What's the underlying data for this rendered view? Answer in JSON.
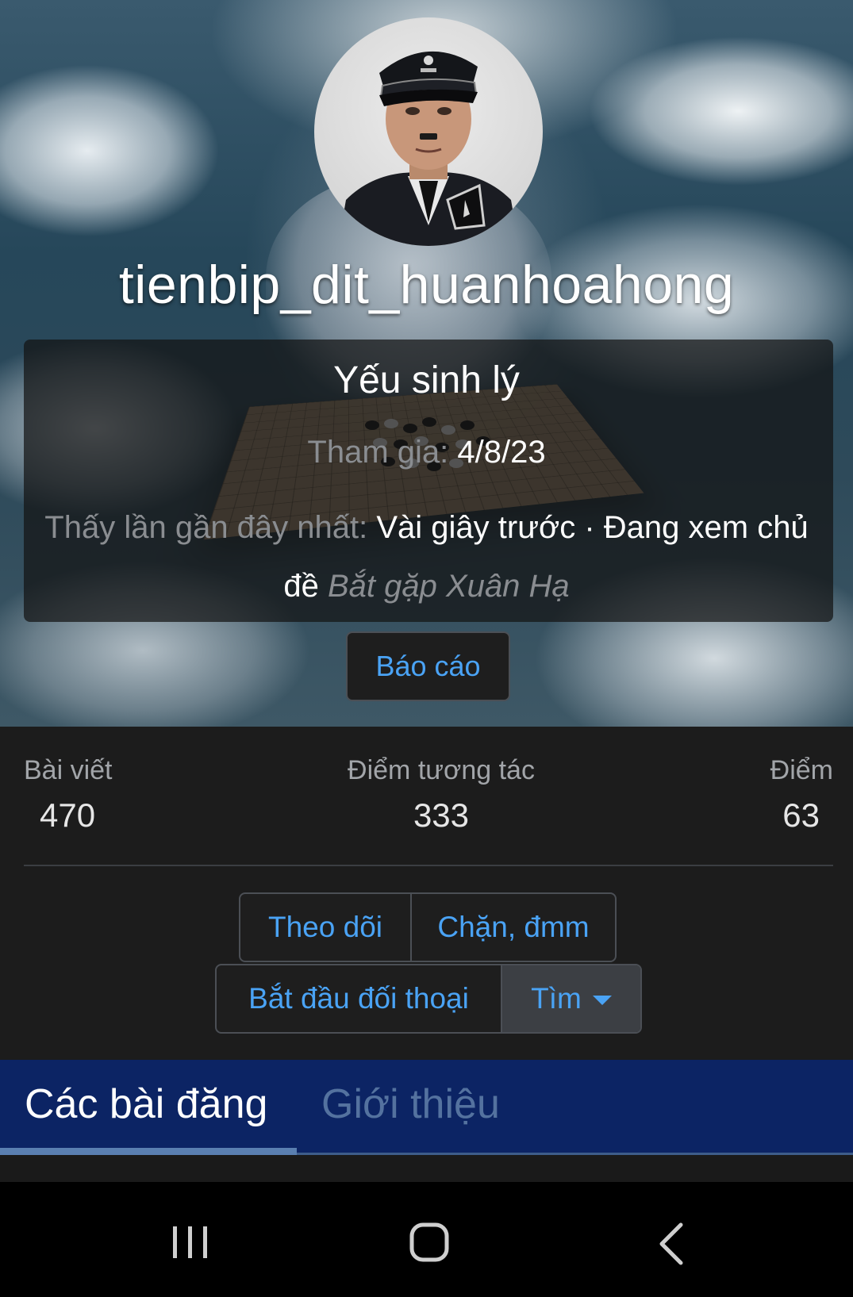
{
  "profile": {
    "username": "tienbip_dit_huanhoahong",
    "user_title": "Yếu sinh lý",
    "joined_label": "Tham gia:",
    "joined_value": "4/8/23",
    "last_seen_label": "Thấy lần gần đây nhất:",
    "last_seen_value": "Vài giây trước · Đang xem chủ đề",
    "last_seen_thread": "Bắt gặp Xuân Hạ",
    "report_label": "Báo cáo"
  },
  "stats": [
    {
      "label": "Bài viết",
      "value": "470"
    },
    {
      "label": "Điểm tương tác",
      "value": "333"
    },
    {
      "label": "Điểm",
      "value": "63"
    }
  ],
  "actions": {
    "follow_label": "Theo dõi",
    "block_label": "Chặn, đmm",
    "start_conversation_label": "Bắt đầu đối thoại",
    "find_label": "Tìm"
  },
  "tabs": [
    {
      "label": "Các bài đăng",
      "active": true
    },
    {
      "label": "Giới thiệu",
      "active": false
    }
  ],
  "navbar": {
    "icons": [
      "recent-apps-icon",
      "home-icon",
      "back-icon"
    ]
  },
  "colors": {
    "link": "#4aa3f5",
    "tab_bar": "#0c2464",
    "background": "#1c1c1c",
    "muted_text": "#8a8d91"
  }
}
